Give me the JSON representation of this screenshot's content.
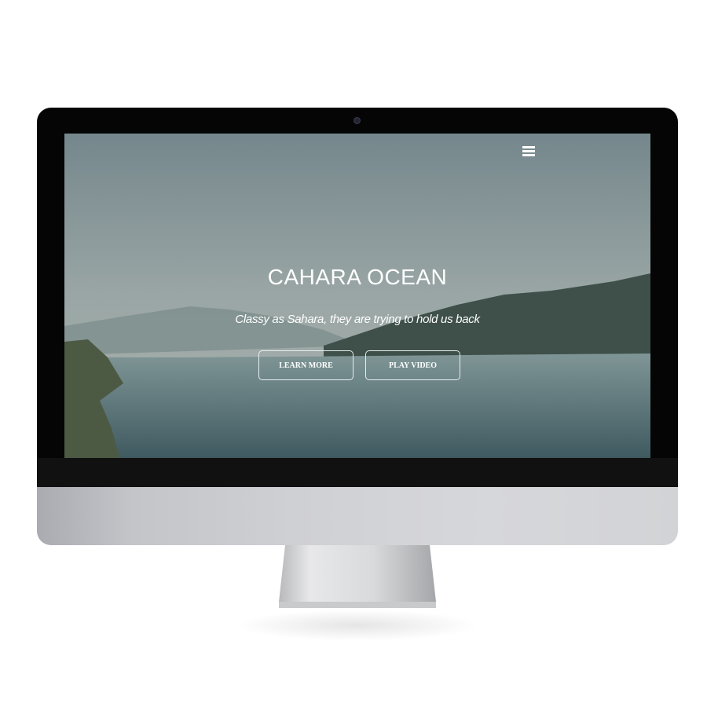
{
  "hero": {
    "title": "CAHARA OCEAN",
    "subtitle": "Classy as Sahara, they are trying to hold us back",
    "buttons": [
      {
        "label": "LEARN MORE"
      },
      {
        "label": "PLAY VIDEO"
      }
    ]
  },
  "nav": {
    "menu_icon": "hamburger-menu-icon"
  },
  "colors": {
    "bezel": "#050505",
    "chin": "#cfd0d4",
    "text": "#ffffff"
  }
}
